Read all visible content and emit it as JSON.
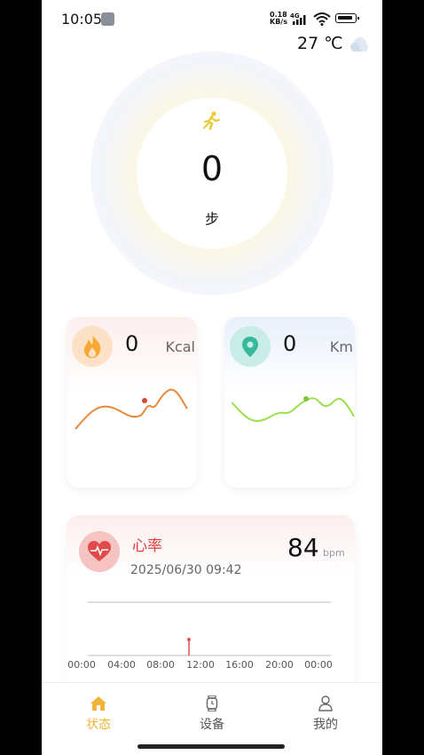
{
  "status": {
    "time": "10:05",
    "net_speed_value": "0.18",
    "net_speed_unit": "KB/s",
    "network": "4G"
  },
  "weather": {
    "temperature": "27 ℃",
    "icon": "cloud-icon"
  },
  "steps": {
    "value": "0",
    "unit": "步",
    "icon": "running-icon"
  },
  "calories": {
    "value": "0",
    "unit": "Kcal",
    "icon": "flame-icon"
  },
  "distance": {
    "value": "0",
    "unit": "Km",
    "icon": "location-pin-icon"
  },
  "heart_rate": {
    "title": "心率",
    "datetime": "2025/06/30 09:42",
    "value": "84",
    "unit": "bpm",
    "icon": "heart-icon",
    "x_ticks": [
      "00:00",
      "04:00",
      "08:00",
      "12:00",
      "16:00",
      "20:00",
      "00:00"
    ]
  },
  "tabs": [
    {
      "label": "状态",
      "icon": "home-icon",
      "active": true
    },
    {
      "label": "设备",
      "icon": "watch-icon",
      "active": false
    },
    {
      "label": "我的",
      "icon": "person-icon",
      "active": false
    }
  ],
  "colors": {
    "accent": "#f0b63a",
    "heart": "#e03c3c",
    "calorie_line": "#e9883a",
    "distance_line": "#9be04c"
  }
}
